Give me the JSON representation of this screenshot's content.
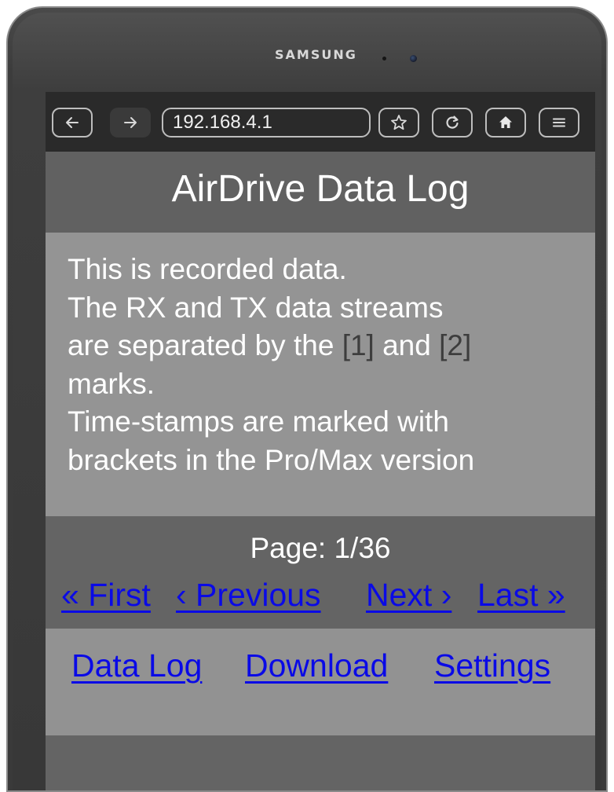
{
  "device": {
    "brand": "SAMSUNG"
  },
  "browser": {
    "back_icon": "arrow-left-icon",
    "forward_icon": "arrow-right-icon",
    "url": "192.168.4.1",
    "bookmark_icon": "star-icon",
    "reload_icon": "reload-icon",
    "home_icon": "home-icon",
    "menu_icon": "hamburger-menu-icon"
  },
  "page": {
    "title": "AirDrive Data Log",
    "info": {
      "line1": "This is recorded data.",
      "line2": "The RX and TX data streams",
      "line3_pre": "are separated by the ",
      "mark1": "[1]",
      "line3_mid": " and ",
      "mark2": "[2]",
      "line4": "marks.",
      "line5": "Time-stamps are marked with",
      "line6": "brackets in the Pro/Max version"
    },
    "pagination": {
      "label": "Page: 1/36",
      "first": "« First",
      "previous": "‹ Previous",
      "next": "Next ›",
      "last": "Last »"
    },
    "nav": {
      "data_log": "Data Log",
      "download": "Download",
      "settings": "Settings"
    }
  },
  "colors": {
    "link": "#0a0ae6",
    "header_bg": "#616161",
    "content_bg": "#949494",
    "mark_text": "#3d3d3d"
  }
}
